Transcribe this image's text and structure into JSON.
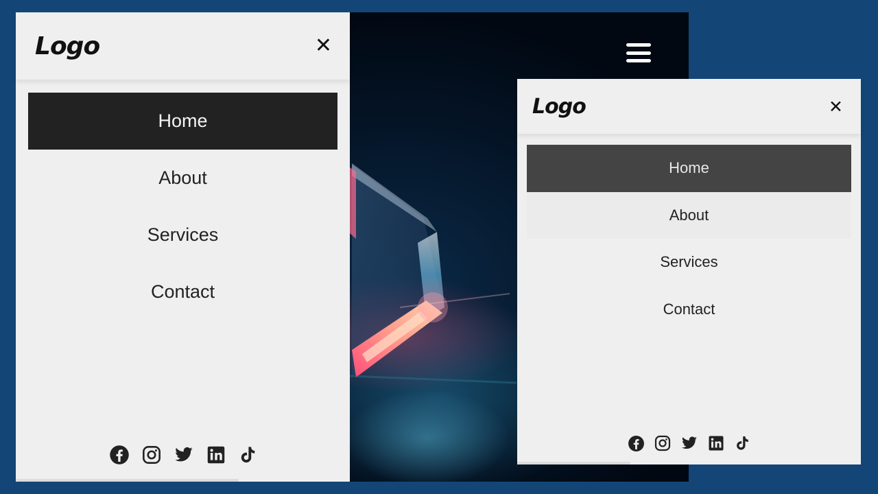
{
  "large_menu": {
    "logo": "Logo",
    "close_symbol": "✕",
    "items": [
      {
        "label": "Home",
        "state": "active"
      },
      {
        "label": "About",
        "state": "normal"
      },
      {
        "label": "Services",
        "state": "normal"
      },
      {
        "label": "Contact",
        "state": "normal"
      }
    ],
    "socials": [
      "facebook-icon",
      "instagram-icon",
      "twitter-icon",
      "linkedin-icon",
      "tiktok-icon"
    ]
  },
  "small_menu": {
    "logo": "Logo",
    "close_symbol": "✕",
    "items": [
      {
        "label": "Home",
        "state": "active"
      },
      {
        "label": "About",
        "state": "hover"
      },
      {
        "label": "Services",
        "state": "normal"
      },
      {
        "label": "Contact",
        "state": "normal"
      }
    ],
    "socials": [
      "facebook-icon",
      "instagram-icon",
      "twitter-icon",
      "linkedin-icon",
      "tiktok-icon"
    ]
  },
  "colors": {
    "page_background": "#134677",
    "panel_background": "#efefef",
    "active_item_large": "#222222",
    "active_item_small": "#444444",
    "hamburger": "#ffffff"
  },
  "hero": {
    "menu_icon": "hamburger-menu-icon"
  }
}
